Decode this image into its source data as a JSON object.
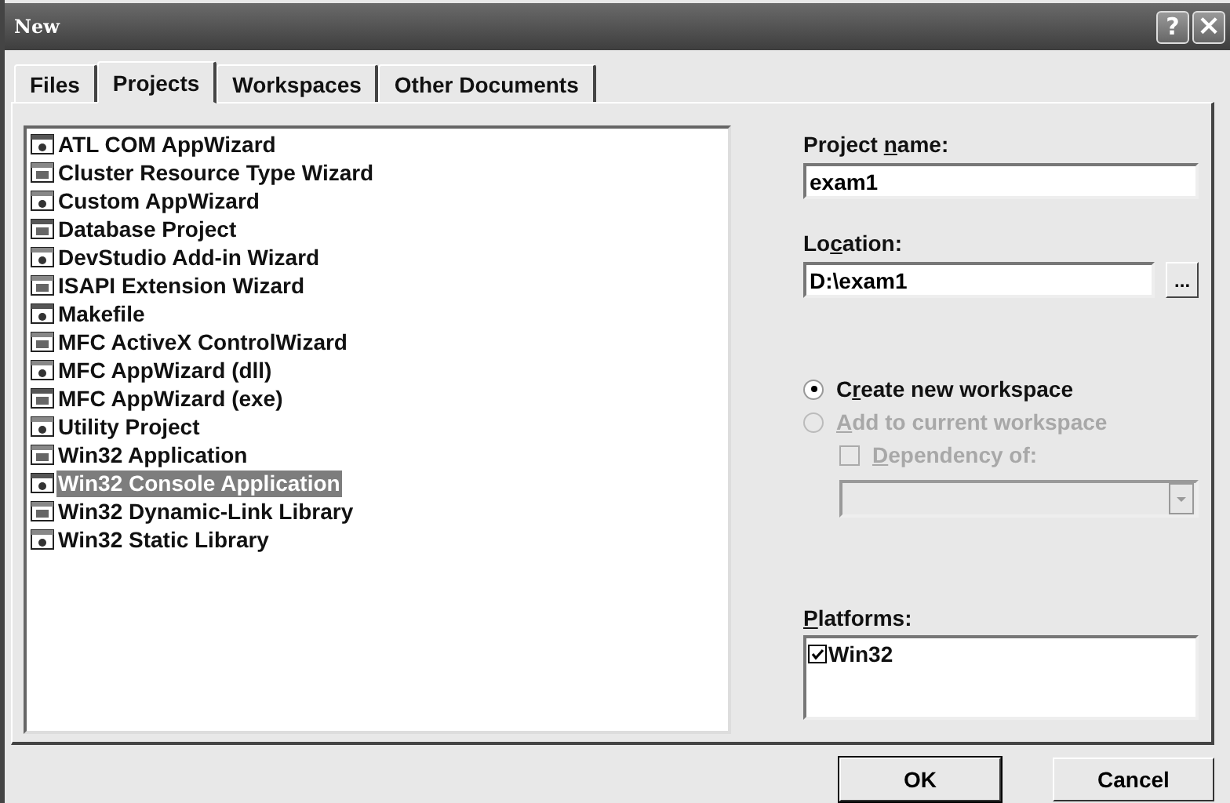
{
  "window": {
    "title": "New"
  },
  "title_buttons": [
    {
      "kind": "help",
      "label": "?"
    },
    {
      "kind": "close",
      "label": "×"
    }
  ],
  "tabs": [
    {
      "label": "Files",
      "selected": false
    },
    {
      "label": "Projects",
      "selected": true
    },
    {
      "label": "Workspaces",
      "selected": false
    },
    {
      "label": "Other Documents",
      "selected": false
    }
  ],
  "project_types": [
    {
      "label": "ATL COM AppWizard",
      "selected": false
    },
    {
      "label": "Cluster Resource Type Wizard",
      "selected": false
    },
    {
      "label": "Custom AppWizard",
      "selected": false
    },
    {
      "label": "Database Project",
      "selected": false
    },
    {
      "label": "DevStudio Add-in Wizard",
      "selected": false
    },
    {
      "label": "ISAPI Extension Wizard",
      "selected": false
    },
    {
      "label": "Makefile",
      "selected": false
    },
    {
      "label": "MFC ActiveX ControlWizard",
      "selected": false
    },
    {
      "label": "MFC AppWizard (dll)",
      "selected": false
    },
    {
      "label": "MFC AppWizard (exe)",
      "selected": false
    },
    {
      "label": "Utility Project",
      "selected": false
    },
    {
      "label": "Win32 Application",
      "selected": false
    },
    {
      "label": "Win32 Console Application",
      "selected": true
    },
    {
      "label": "Win32 Dynamic-Link Library",
      "selected": false
    },
    {
      "label": "Win32 Static Library",
      "selected": false
    }
  ],
  "project_name": {
    "label": {
      "pre": "Project ",
      "key": "n",
      "post": "ame:"
    },
    "value": "exam1"
  },
  "location": {
    "label": {
      "pre": "Lo",
      "key": "c",
      "post": "ation:"
    },
    "value": "D:\\exam1",
    "browse": "..."
  },
  "workspace_options": [
    {
      "label": {
        "pre": "C",
        "key": "r",
        "post": "eate new workspace"
      },
      "selected": true,
      "disabled": false
    },
    {
      "label": {
        "key": "A",
        "post": "dd to current workspace"
      },
      "selected": false,
      "disabled": true
    }
  ],
  "dependency": {
    "label": {
      "key": "D",
      "post": "ependency of:"
    },
    "checked": false,
    "disabled": true
  },
  "dependency_dropdown": {
    "disabled": true
  },
  "platforms": {
    "label": {
      "key": "P",
      "post": "latforms:"
    },
    "items": [
      {
        "label": "Win32",
        "checked": true
      }
    ]
  },
  "buttons": [
    "OK",
    "Cancel"
  ]
}
